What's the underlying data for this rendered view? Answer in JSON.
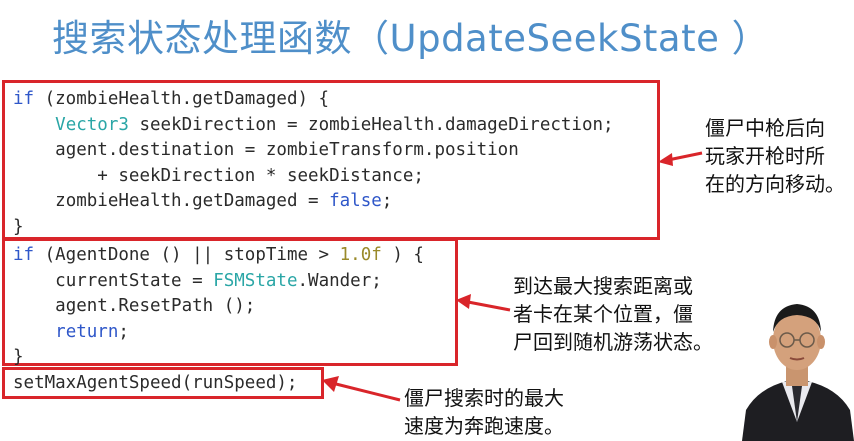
{
  "title": "搜索状态处理函数（UpdateSeekState ）",
  "block1": {
    "lines": [
      {
        "indent": "",
        "parts": [
          {
            "c": "kw",
            "t": "if"
          },
          {
            "c": "",
            "t": " (zombieHealth.getDamaged) {"
          }
        ]
      },
      {
        "indent": "    ",
        "parts": [
          {
            "c": "ty",
            "t": "Vector3"
          },
          {
            "c": "",
            "t": " seekDirection = zombieHealth.damageDirection;"
          }
        ]
      },
      {
        "indent": "    ",
        "parts": [
          {
            "c": "",
            "t": "agent.destination = zombieTransform.position"
          }
        ]
      },
      {
        "indent": "        ",
        "parts": [
          {
            "c": "",
            "t": "+ seekDirection * seekDistance;"
          }
        ]
      },
      {
        "indent": "    ",
        "parts": [
          {
            "c": "",
            "t": "zombieHealth.getDamaged = "
          },
          {
            "c": "kw",
            "t": "false"
          },
          {
            "c": "",
            "t": ";"
          }
        ]
      },
      {
        "indent": "",
        "parts": [
          {
            "c": "",
            "t": "}"
          }
        ]
      }
    ],
    "note": [
      "僵尸中枪后向",
      "玩家开枪时所",
      "在的方向移动。"
    ]
  },
  "block2": {
    "lines": [
      {
        "indent": "",
        "parts": [
          {
            "c": "kw",
            "t": "if"
          },
          {
            "c": "",
            "t": " (AgentDone () || stopTime > "
          },
          {
            "c": "lit",
            "t": "1.0f"
          },
          {
            "c": "",
            "t": " ) {"
          }
        ]
      },
      {
        "indent": "    ",
        "parts": [
          {
            "c": "",
            "t": "currentState = "
          },
          {
            "c": "ty",
            "t": "FSMState"
          },
          {
            "c": "",
            "t": ".Wander;"
          }
        ]
      },
      {
        "indent": "    ",
        "parts": [
          {
            "c": "",
            "t": "agent.ResetPath ();"
          }
        ]
      },
      {
        "indent": "    ",
        "parts": [
          {
            "c": "kw",
            "t": "return"
          },
          {
            "c": "",
            "t": ";"
          }
        ]
      },
      {
        "indent": "",
        "parts": [
          {
            "c": "",
            "t": "}"
          }
        ]
      }
    ],
    "note": [
      "到达最大搜索距离或",
      "者卡在某个位置，僵",
      "尸回到随机游荡状态。"
    ]
  },
  "block3": {
    "lines": [
      {
        "indent": "",
        "parts": [
          {
            "c": "",
            "t": "setMaxAgentSpeed(runSpeed);"
          }
        ]
      }
    ],
    "note": [
      "僵尸搜索时的最大",
      "速度为奔跑速度。"
    ]
  },
  "colors": {
    "accent_red": "#d9252a",
    "title_blue": "#4f8fc9",
    "keyword_blue": "#2f57c9",
    "type_teal": "#2aa6a6"
  },
  "presenter_icon": "presenter-video-thumbnail"
}
